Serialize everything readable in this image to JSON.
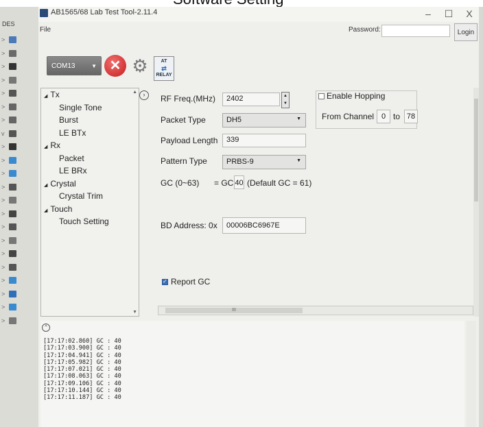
{
  "overlay_caption": "Software Setting",
  "window": {
    "title": "AB1565/68 Lab Test Tool-2.11.4",
    "controls": {
      "minimize": "–",
      "maximize": "☐",
      "close": "X"
    }
  },
  "explorer": {
    "header": "DES",
    "items": [
      {
        "chevron": ">",
        "icon": "monitor-icon",
        "color": "#4a7ab8"
      },
      {
        "chevron": ">",
        "icon": "building-icon",
        "color": "#6a6a6a"
      },
      {
        "chevron": ">",
        "icon": "window-icon",
        "color": "#333333"
      },
      {
        "chevron": ">",
        "icon": "drive-icon",
        "color": "#777777"
      },
      {
        "chevron": ">",
        "icon": "network-icon",
        "color": "#555555"
      },
      {
        "chevron": ">",
        "icon": "printer-icon",
        "color": "#666666"
      },
      {
        "chevron": ">",
        "icon": "printer-icon",
        "color": "#666666"
      },
      {
        "chevron": "v",
        "icon": "usb-icon",
        "color": "#555555"
      },
      {
        "chevron": ">",
        "icon": "server-icon",
        "color": "#333333"
      },
      {
        "chevron": ">",
        "icon": "display-icon",
        "color": "#3a8ad0"
      },
      {
        "chevron": ">",
        "icon": "display-icon",
        "color": "#3a8ad0"
      },
      {
        "chevron": ">",
        "icon": "keyboard-icon",
        "color": "#555555"
      },
      {
        "chevron": ">",
        "icon": "device-icon",
        "color": "#777777"
      },
      {
        "chevron": ">",
        "icon": "battery-icon",
        "color": "#444444"
      },
      {
        "chevron": ">",
        "icon": "device-icon",
        "color": "#555555"
      },
      {
        "chevron": ">",
        "icon": "speaker-icon",
        "color": "#777777"
      },
      {
        "chevron": ">",
        "icon": "mouse-icon",
        "color": "#444444"
      },
      {
        "chevron": ">",
        "icon": "usb-icon",
        "color": "#555555"
      },
      {
        "chevron": ">",
        "icon": "display-icon",
        "color": "#3a8ad0"
      },
      {
        "chevron": ">",
        "icon": "folder-icon",
        "color": "#2d6fb8"
      },
      {
        "chevron": ">",
        "icon": "display-icon",
        "color": "#3a8ad0"
      },
      {
        "chevron": ">",
        "icon": "speaker-icon",
        "color": "#777777"
      }
    ]
  },
  "menu": {
    "file": "File"
  },
  "auth": {
    "password_label": "Password:",
    "password_value": "",
    "login": "Login"
  },
  "toolbar": {
    "port": "COM13",
    "disconnect_icon": "✕",
    "settings_icon": "⚙",
    "relay_top": "AT",
    "relay_bottom": "RELAY"
  },
  "tree": {
    "items": [
      {
        "label": "Tx",
        "level": 0,
        "expanded": true
      },
      {
        "label": "Single Tone",
        "level": 1
      },
      {
        "label": "Burst",
        "level": 1
      },
      {
        "label": "LE BTx",
        "level": 1
      },
      {
        "label": "Rx",
        "level": 0,
        "expanded": true
      },
      {
        "label": "Packet",
        "level": 1
      },
      {
        "label": "LE BRx",
        "level": 1
      },
      {
        "label": "Crystal",
        "level": 0,
        "expanded": true
      },
      {
        "label": "Crystal Trim",
        "level": 1
      },
      {
        "label": "Touch",
        "level": 0,
        "expanded": true
      },
      {
        "label": "Touch Setting",
        "level": 1
      }
    ]
  },
  "form": {
    "rf_freq": {
      "label": "RF Freq.(MHz)",
      "value": "2402"
    },
    "packet_type": {
      "label": "Packet Type",
      "value": "DH5"
    },
    "payload_length": {
      "label": "Payload Length",
      "value": "339"
    },
    "pattern_type": {
      "label": "Pattern Type",
      "value": "PRBS-9"
    },
    "gc": {
      "label": "GC (0~63)",
      "prefix": "= GC",
      "value": "40",
      "default": "(Default GC = 61)"
    },
    "bd_address": {
      "label": "BD Address: 0x",
      "value": "00006BC6967E"
    },
    "report_gc": {
      "label": "Report GC",
      "checked": true
    },
    "hopping": {
      "label": "Enable Hopping",
      "checked": false,
      "from_label": "From Channel",
      "from_value": "0",
      "to_label": "to",
      "to_value": "78"
    }
  },
  "scroll": {
    "thumb_grip": "III"
  },
  "log": {
    "collapse_icon": "^",
    "lines": [
      "[17:17:02.860] GC : 40",
      "[17:17:03.900] GC : 40",
      "[17:17:04.941] GC : 40",
      "[17:17:05.982] GC : 40",
      "[17:17:07.021] GC : 40",
      "[17:17:08.063] GC : 40",
      "[17:17:09.106] GC : 40",
      "[17:17:10.144] GC : 40",
      "[17:17:11.187] GC : 40"
    ]
  }
}
